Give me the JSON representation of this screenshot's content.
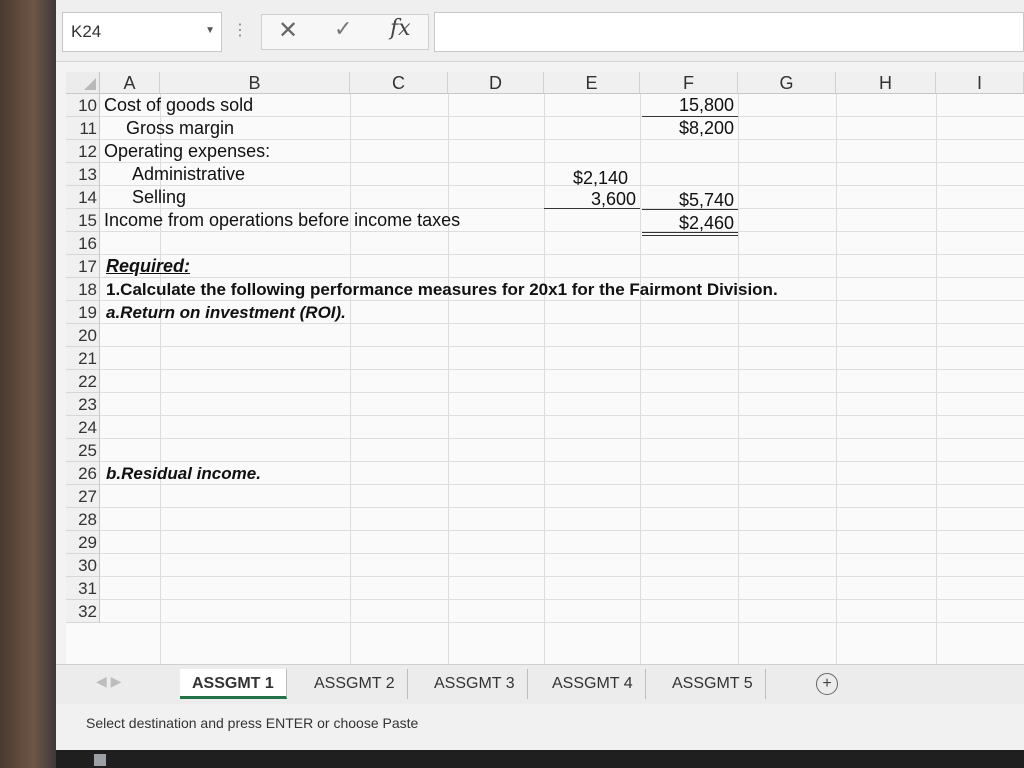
{
  "formula_bar": {
    "name_box": "K24",
    "cancel_icon": "✕",
    "enter_icon": "✓",
    "function_label": "fx",
    "dots_icon": "⋮",
    "formula_value": ""
  },
  "columns": [
    "A",
    "B",
    "C",
    "D",
    "E",
    "F",
    "G",
    "H",
    "I"
  ],
  "rows": [
    "10",
    "11",
    "12",
    "13",
    "14",
    "15",
    "16",
    "17",
    "18",
    "19",
    "20",
    "21",
    "22",
    "23",
    "24",
    "25",
    "26",
    "27",
    "28",
    "29",
    "30",
    "31",
    "32"
  ],
  "cells": {
    "r10_label": "Cost of goods sold",
    "r10_f": "15,800",
    "r11_label": "Gross margin",
    "r11_f": "$8,200",
    "r12_label": "Operating expenses:",
    "r13_label": "Administrative",
    "r13_e": "$2,140",
    "r14_label": "Selling",
    "r14_e": "3,600",
    "r14_f": "$5,740",
    "r15_label": "Income from operations before income taxes",
    "r15_f": "$2,460",
    "r17_label": "Required:",
    "r18_label": "1.Calculate the following performance measures for 20x1 for the Fairmont Division.",
    "r19_label": "a.Return on investment (ROI).",
    "r26_label": "b.Residual income."
  },
  "sheet_tabs": [
    "ASSGMT 1",
    "ASSGMT 2",
    "ASSGMT 3",
    "ASSGMT 4",
    "ASSGMT 5"
  ],
  "add_sheet_icon": "+",
  "status_text": "Select destination and press ENTER or choose Paste"
}
